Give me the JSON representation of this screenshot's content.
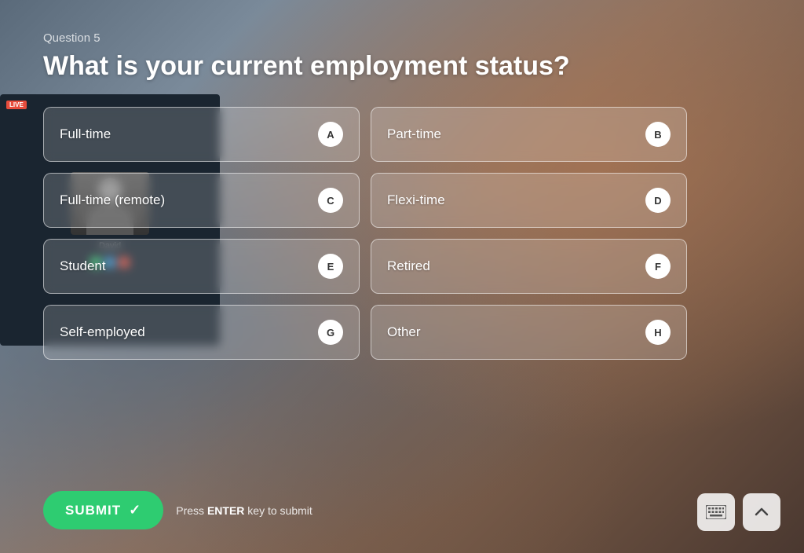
{
  "question": {
    "number": "Question 5",
    "title": "What is your current employment status?"
  },
  "options": [
    {
      "id": "A",
      "label": "Full-time"
    },
    {
      "id": "B",
      "label": "Part-time"
    },
    {
      "id": "C",
      "label": "Full-time (remote)"
    },
    {
      "id": "D",
      "label": "Flexi-time"
    },
    {
      "id": "E",
      "label": "Student"
    },
    {
      "id": "F",
      "label": "Retired"
    },
    {
      "id": "G",
      "label": "Self-employed"
    },
    {
      "id": "H",
      "label": "Other"
    }
  ],
  "submit": {
    "label": "SUBMIT",
    "hint_prefix": "Press ",
    "hint_key": "ENTER",
    "hint_suffix": " key to submit"
  },
  "laptop": {
    "live_label": "LIVE",
    "person_name": "David"
  },
  "icon_colors": {
    "dot1": "#2ecc71",
    "dot2": "#3498db",
    "dot3": "#e74c3c"
  }
}
